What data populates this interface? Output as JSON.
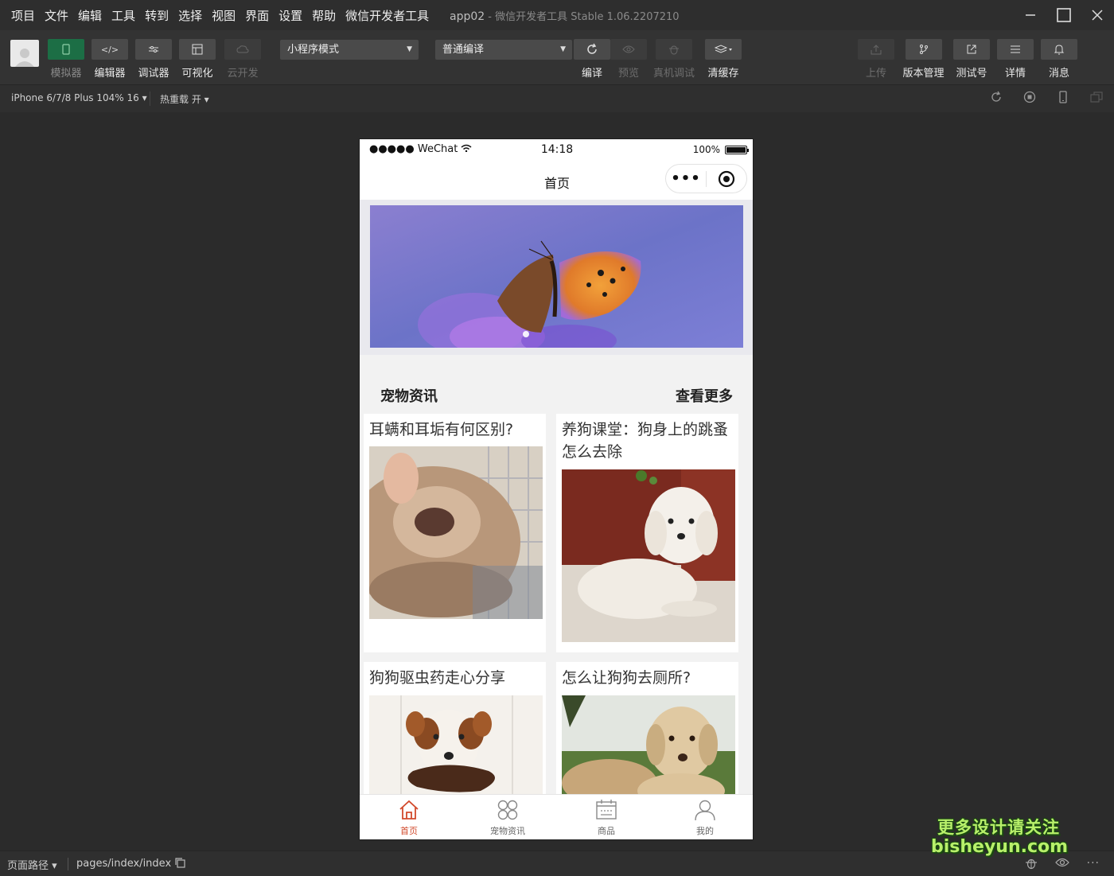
{
  "menubar": {
    "items": [
      "项目",
      "文件",
      "编辑",
      "工具",
      "转到",
      "选择",
      "视图",
      "界面",
      "设置",
      "帮助",
      "微信开发者工具"
    ],
    "app_name": "app02",
    "window_title": " - 微信开发者工具 Stable 1.06.2207210"
  },
  "toolbar": {
    "left_tools": [
      {
        "label": "模拟器",
        "icon": "phone-icon",
        "state": "active"
      },
      {
        "label": "编辑器",
        "icon": "code-icon",
        "state": "normal"
      },
      {
        "label": "调试器",
        "icon": "debug-sliders-icon",
        "state": "normal"
      },
      {
        "label": "可视化",
        "icon": "layout-icon",
        "state": "normal"
      },
      {
        "label": "云开发",
        "icon": "cloud-icon",
        "state": "disabled"
      }
    ],
    "mode_select": "小程序模式",
    "compile_select": "普通编译",
    "mid_tools": [
      {
        "label": "编译",
        "icon": "refresh-icon",
        "state": "normal"
      },
      {
        "label": "预览",
        "icon": "eye-icon",
        "state": "disabled"
      },
      {
        "label": "真机调试",
        "icon": "bug-icon",
        "state": "disabled"
      },
      {
        "label": "清缓存",
        "icon": "layers-icon",
        "state": "normal"
      }
    ],
    "right_tools": [
      {
        "label": "上传",
        "icon": "upload-icon",
        "state": "disabled"
      },
      {
        "label": "版本管理",
        "icon": "branch-icon",
        "state": "normal"
      },
      {
        "label": "测试号",
        "icon": "external-link-icon",
        "state": "normal"
      },
      {
        "label": "详情",
        "icon": "menu-icon",
        "state": "normal"
      },
      {
        "label": "消息",
        "icon": "bell-icon",
        "state": "normal"
      }
    ]
  },
  "subbar": {
    "device": "iPhone 6/7/8 Plus 104% 16 ▾",
    "hot_reload": "热重载 开 ▾"
  },
  "phone": {
    "status": {
      "carrier": "●●●●● WeChat",
      "time": "14:18",
      "battery": "100%"
    },
    "nav_title": "首页",
    "section_title": "宠物资讯",
    "section_more": "查看更多",
    "cards": [
      {
        "title": "耳螨和耳垢有何区别?",
        "image": "cat-ear-photo"
      },
      {
        "title": "养狗课堂：狗身上的跳蚤怎么去除",
        "image": "white-poodle-photo"
      },
      {
        "title": "狗狗驱虫药走心分享",
        "image": "dog-with-leash-photo"
      },
      {
        "title": "怎么让狗狗去厕所?",
        "image": "labrador-photo"
      }
    ],
    "tabs": [
      {
        "label": "首页",
        "icon": "home-icon",
        "active": true
      },
      {
        "label": "宠物资讯",
        "icon": "grid-icon",
        "active": false
      },
      {
        "label": "商品",
        "icon": "calendar-icon",
        "active": false
      },
      {
        "label": "我的",
        "icon": "user-icon",
        "active": false
      }
    ]
  },
  "statusline": {
    "path_label": "页面路径 ▾",
    "path": "pages/index/index"
  },
  "watermark": {
    "line1": "更多设计请关注",
    "line2": "bisheyun.com"
  },
  "colors": {
    "accent_green": "#1c6e45",
    "tab_active": "#d24a2c",
    "watermark": "#b8f06a"
  }
}
